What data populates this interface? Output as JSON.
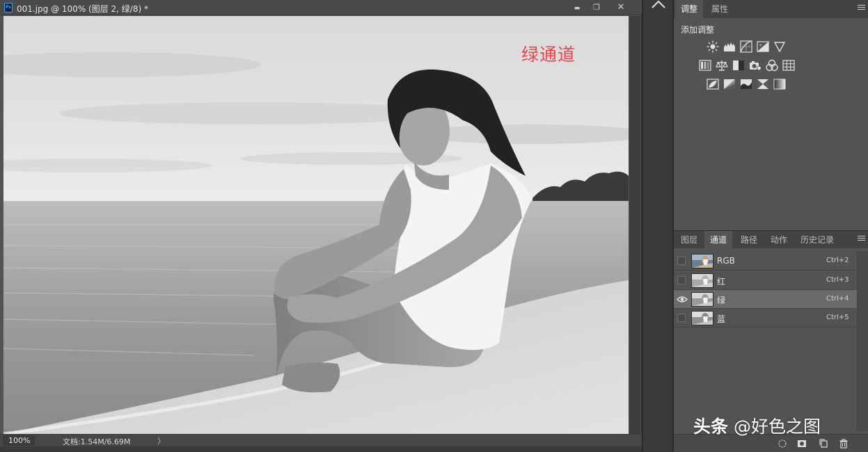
{
  "document": {
    "title": "001.jpg @ 100% (图层 2, 绿/8) *",
    "app_icon": "ps-file-icon",
    "app_badge": "Ps",
    "overlay_text": "绿通道",
    "overlay_color": "#e8464e",
    "zoom": "100%",
    "doc_info": "文档:1.54M/6.69M",
    "status_arrow": "〉",
    "window_buttons": {
      "minimize": "▬",
      "maximize": "❐",
      "close": "✕"
    }
  },
  "adjustments_panel": {
    "tabs": [
      "调整",
      "属性"
    ],
    "active_tab": "调整",
    "heading": "添加调整",
    "icon_rows": [
      [
        "brightness-contrast-icon",
        "levels-icon",
        "curves-icon",
        "exposure-icon",
        "vibrance-icon"
      ],
      [
        "hue-saturation-icon",
        "color-balance-icon",
        "black-white-icon",
        "photo-filter-icon",
        "channel-mixer-icon",
        "color-lookup-icon"
      ],
      [
        "invert-icon",
        "posterize-icon",
        "threshold-icon",
        "selective-color-icon",
        "gradient-map-icon"
      ]
    ]
  },
  "channels_panel": {
    "tabs": [
      "图层",
      "通道",
      "路径",
      "动作",
      "历史记录"
    ],
    "active_tab": "通道",
    "channels": [
      {
        "name": "RGB",
        "shortcut": "Ctrl+2",
        "visible": false,
        "selected": false,
        "thumb": "color"
      },
      {
        "name": "红",
        "shortcut": "Ctrl+3",
        "visible": false,
        "selected": false,
        "thumb": "gray"
      },
      {
        "name": "绿",
        "shortcut": "Ctrl+4",
        "visible": true,
        "selected": true,
        "thumb": "gray"
      },
      {
        "name": "蓝",
        "shortcut": "Ctrl+5",
        "visible": false,
        "selected": false,
        "thumb": "gray"
      }
    ],
    "bottom_icons": [
      "load-selection-icon",
      "save-selection-icon",
      "new-channel-icon",
      "delete-channel-icon"
    ]
  },
  "watermark": {
    "bold": "头条",
    "rest": " @好色之图"
  }
}
